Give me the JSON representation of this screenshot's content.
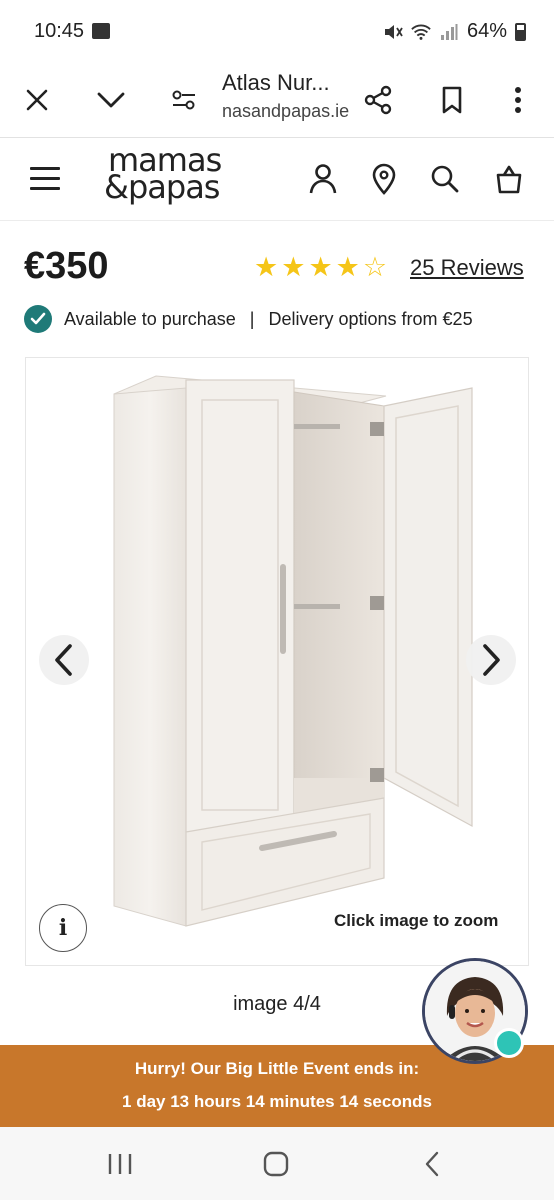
{
  "status": {
    "time": "10:45",
    "battery": "64%"
  },
  "browser": {
    "title": "Atlas Nur...",
    "domain": "nasandpapas.ie"
  },
  "header": {
    "logo_line1": "mamas",
    "logo_line2": "&papas"
  },
  "product": {
    "price": "€350",
    "rating": 4,
    "rating_max": 5,
    "reviews_label": "25 Reviews",
    "availability": "Available to purchase",
    "separator": "|",
    "delivery": "Delivery options from €25"
  },
  "gallery": {
    "zoom_hint": "Click image to zoom",
    "info_label": "i",
    "counter": "image 4/4"
  },
  "promo": {
    "line1": "Hurry! Our Big Little Event ends in:",
    "line2": "1 day 13 hours 14 minutes 14 seconds"
  },
  "colors": {
    "brand_teal": "#1f7a78",
    "star": "#f5c518",
    "promo_bg": "#c8772b",
    "online": "#2ec4b6"
  },
  "icons": {
    "close": "close-icon",
    "chevron": "chevron-down-icon",
    "tune": "page-settings-icon",
    "share": "share-icon",
    "bookmark": "bookmark-icon",
    "more": "more-vert-icon",
    "menu": "menu-icon",
    "account": "account-icon",
    "location": "location-icon",
    "search": "search-icon",
    "bag": "bag-icon"
  }
}
